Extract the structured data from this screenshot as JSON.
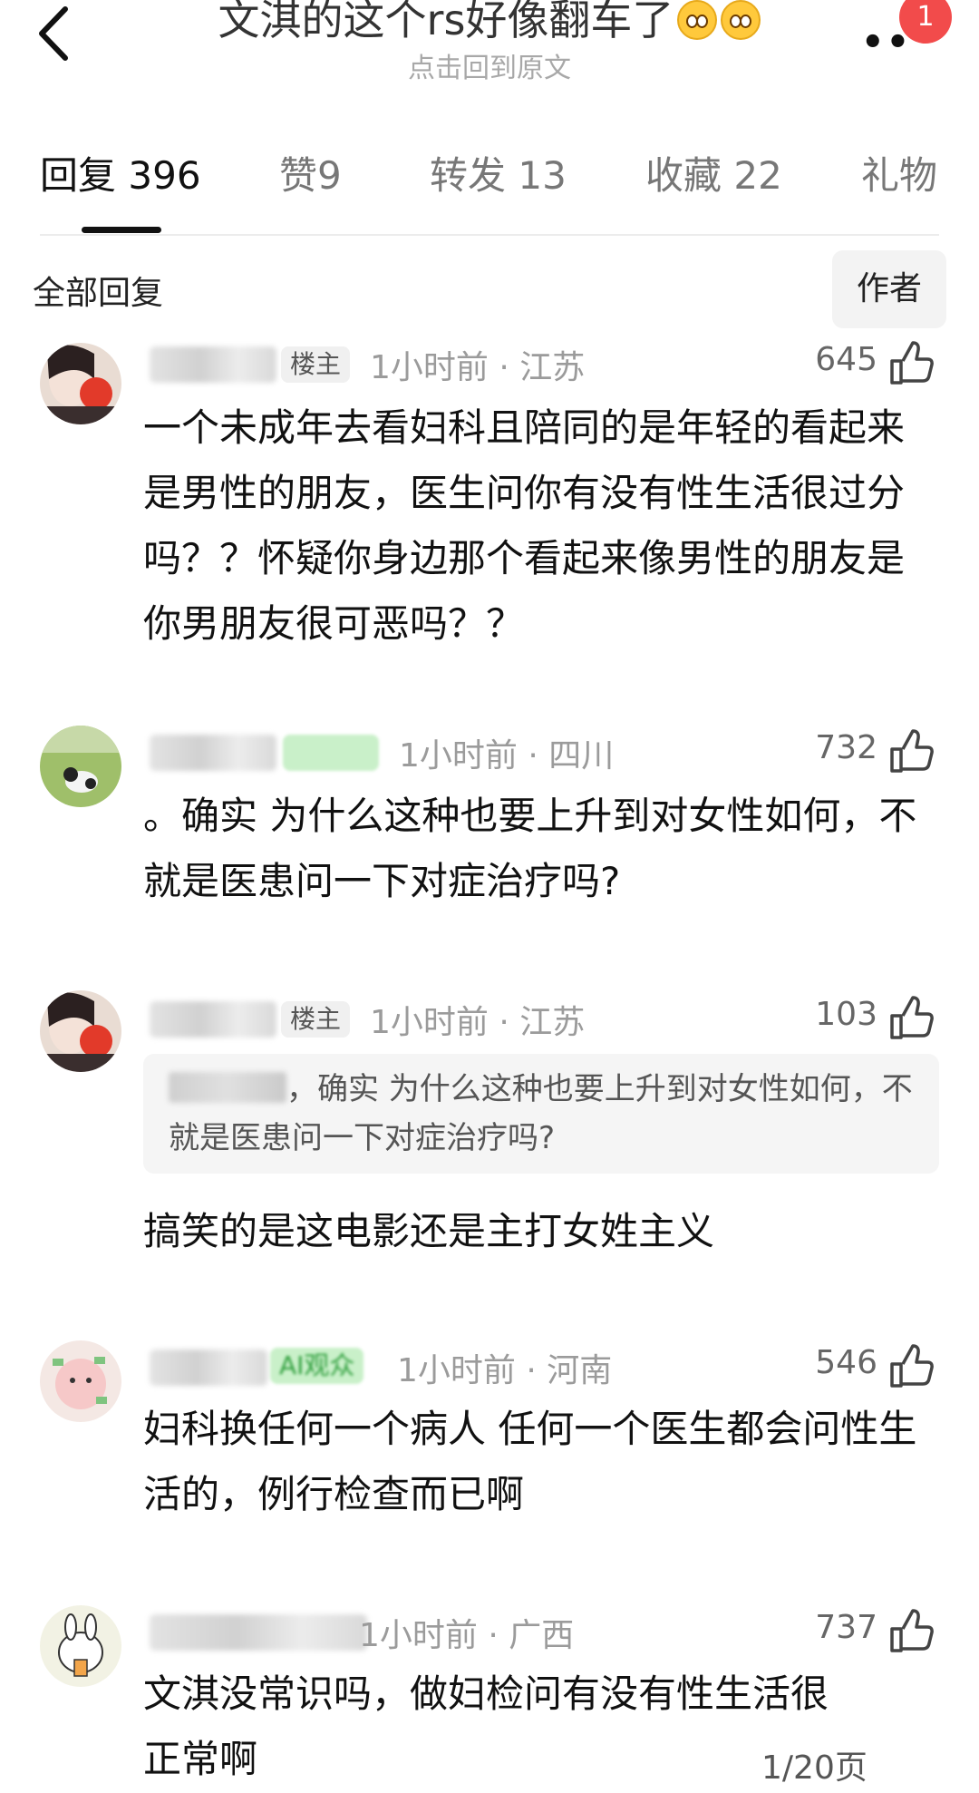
{
  "header": {
    "title": "文淇的这个rs好像翻车了",
    "emoji_icons": [
      "flushed-face-icon",
      "flushed-face-icon"
    ],
    "subtitle": "点击回到原文",
    "more_icon": "ellipsis-icon",
    "badge_count": "1"
  },
  "tabs": [
    {
      "label": "回复",
      "count": "396",
      "active": true
    },
    {
      "label": "赞",
      "count": "9",
      "active": false
    },
    {
      "label": "转发",
      "count": "13",
      "active": false
    },
    {
      "label": "收藏",
      "count": "22",
      "active": false
    },
    {
      "label": "礼物",
      "count": "",
      "active": false
    }
  ],
  "section": {
    "title": "全部回复",
    "author_button": "作者"
  },
  "comments": [
    {
      "tag": "楼主",
      "time": "1小时前",
      "location": "江苏",
      "likes": "645",
      "text": "一个未成年去看妇科且陪同的是年轻的看起来是男性的朋友，医生问你有没有性生活很过分吗？？怀疑你身边那个看起来像男性的朋友是你男朋友很可恶吗？？"
    },
    {
      "tag": "",
      "time": "1小时前",
      "location": "四川",
      "likes": "732",
      "text": "。确实 为什么这种也要上升到对女性如何，不就是医患问一下对症治疗吗?"
    },
    {
      "tag": "楼主",
      "time": "1小时前",
      "location": "江苏",
      "likes": "103",
      "quote": "，确实 为什么这种也要上升到对女性如何，不就是医患问一下对症治疗吗?",
      "text": "搞笑的是这电影还是主打女姓主义"
    },
    {
      "tag": "AI观众",
      "time": "1小时前",
      "location": "河南",
      "likes": "546",
      "text": "妇科换任何一个病人 任何一个医生都会问性生活的，例行检查而已啊"
    },
    {
      "tag": "",
      "time": "1小时前",
      "location": "广西",
      "likes": "737",
      "text": "文淇没常识吗，做妇检问有没有性生活很正常啊"
    }
  ],
  "pagination": "1/20页",
  "like_icon": "thumbs-up-icon",
  "back_icon": "chevron-left-icon"
}
